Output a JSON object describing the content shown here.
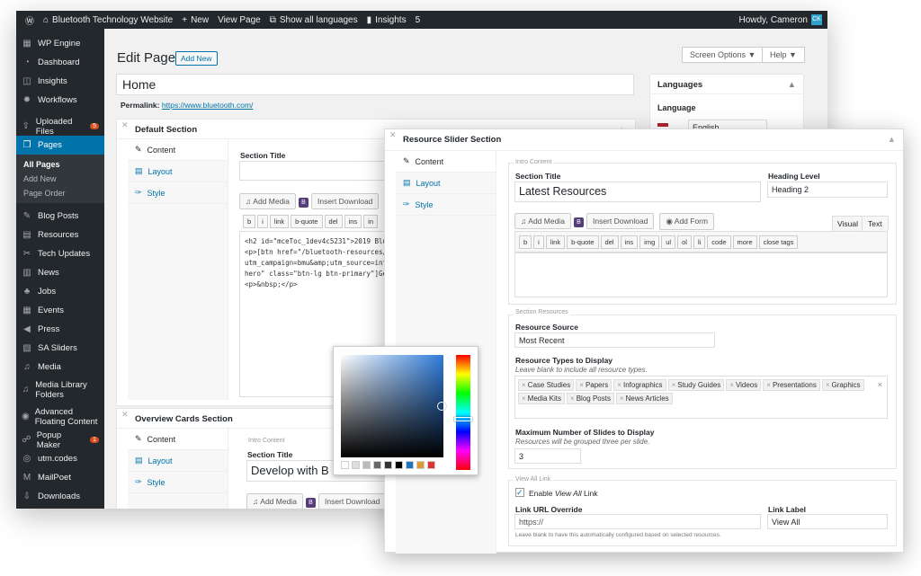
{
  "adminbar": {
    "site": "Bluetooth Technology Website",
    "new": "New",
    "view": "View Page",
    "lang": "Show all languages",
    "insights": "Insights",
    "count": "5",
    "howdy": "Howdy, Cameron",
    "avatar": "CK"
  },
  "sidebar": {
    "items": [
      {
        "label": "WP Engine",
        "icon": "wp-engine-icon"
      },
      {
        "label": "Dashboard",
        "icon": "dashboard-icon"
      },
      {
        "label": "Insights",
        "icon": "insights-icon"
      },
      {
        "label": "Workflows",
        "icon": "workflows-icon"
      },
      {
        "label": "Uploaded Files",
        "icon": "upload-icon",
        "badge": "5"
      },
      {
        "label": "Pages",
        "icon": "pages-icon"
      }
    ],
    "sub": [
      "All Pages",
      "Add New",
      "Page Order"
    ],
    "items2": [
      {
        "label": "Blog Posts"
      },
      {
        "label": "Resources"
      },
      {
        "label": "Tech Updates"
      },
      {
        "label": "News"
      },
      {
        "label": "Jobs"
      },
      {
        "label": "Events"
      },
      {
        "label": "Press"
      },
      {
        "label": "SA Sliders"
      },
      {
        "label": "Media"
      },
      {
        "label": "Media Library Folders"
      },
      {
        "label": "Advanced Floating Content"
      },
      {
        "label": "Popup Maker",
        "badge": "1"
      },
      {
        "label": "utm.codes"
      },
      {
        "label": "MailPoet"
      },
      {
        "label": "Downloads"
      }
    ]
  },
  "page": {
    "title": "Edit Page",
    "add_new": "Add New",
    "screen_options": "Screen Options ▼",
    "help": "Help ▼",
    "post_title": "Home",
    "permalink_label": "Permalink:",
    "permalink_url": "https://www.bluetooth.com/"
  },
  "languages": {
    "title": "Languages",
    "label": "Language",
    "value": "English"
  },
  "default_section": {
    "title": "Default Section",
    "tabs": [
      "Content",
      "Layout",
      "Style"
    ],
    "section_title": "Section Title",
    "add_media": "Add Media",
    "insert_download": "Insert Download",
    "qt": [
      "b",
      "i",
      "link",
      "b-quote",
      "del",
      "ins",
      "in"
    ],
    "code": [
      "<h2 id=\"mceToc_1dev4c5231\">2019 Blu",
      "<p>[btn href=\"/bluetooth-resources/",
      "utm_campaign=bmu&amp;utm_source=int",
      "hero\" class=\"btn-lg btn-primary\"]Ge",
      "<p>&nbsp;</p>"
    ]
  },
  "overview": {
    "title": "Overview Cards Section",
    "tabs": [
      "Content",
      "Layout",
      "Style"
    ],
    "intro": "Intro Content",
    "section_title": "Section Title",
    "value": "Develop with B",
    "add_media": "Add Media",
    "insert_download": "Insert Download"
  },
  "slider": {
    "title": "Resource Slider Section",
    "tabs": [
      "Content",
      "Layout",
      "Style"
    ],
    "intro": "Intro Content",
    "section_title": "Section Title",
    "title_value": "Latest Resources",
    "heading_level": "Heading Level",
    "heading_value": "Heading 2",
    "add_media": "Add Media",
    "insert_download": "Insert Download",
    "add_form": "Add Form",
    "visual": "Visual",
    "text": "Text",
    "qt": [
      "b",
      "i",
      "link",
      "b-quote",
      "del",
      "ins",
      "img",
      "ul",
      "ol",
      "li",
      "code",
      "more",
      "close tags"
    ],
    "resources_legend": "Section Resources",
    "source_label": "Resource Source",
    "source_value": "Most Recent",
    "types_label": "Resource Types to Display",
    "types_help": "Leave blank to include all resource types.",
    "types": [
      "Case Studies",
      "Papers",
      "Infographics",
      "Study Guides",
      "Videos",
      "Presentations",
      "Graphics",
      "Media Kits",
      "Blog Posts",
      "News Articles"
    ],
    "max_label": "Maximum Number of Slides to Display",
    "max_help": "Resources will be grouped three per slide.",
    "max_value": "3",
    "viewall_legend": "View All Link",
    "enable_prefix": "Enable ",
    "enable_em": "View All",
    "enable_suffix": " Link",
    "url_label": "Link URL Override",
    "url_value": "https://",
    "link_label": "Link Label",
    "link_value": "View All",
    "url_help": "Leave blank to have this automatically configured based on selected resources."
  },
  "colors": {
    "accent": "#0073aa",
    "swatches": [
      "#ffffff",
      "#dddddd",
      "#bbbbbb",
      "#666666",
      "#333333",
      "#000000",
      "#1e73be",
      "#dd9933",
      "#dd3333"
    ]
  }
}
